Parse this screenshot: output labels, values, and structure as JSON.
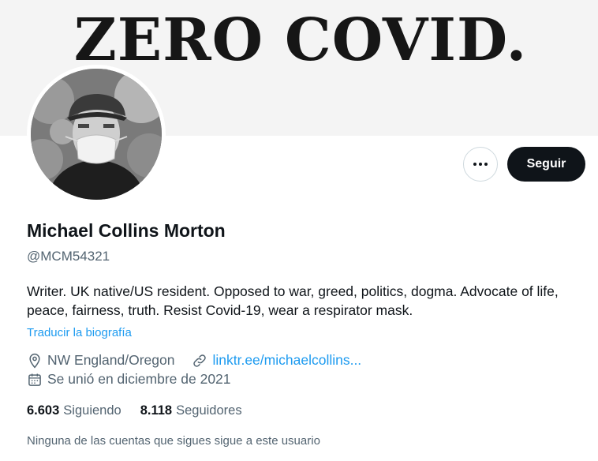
{
  "banner": {
    "text": "ZERO COVID."
  },
  "actions": {
    "follow_label": "Seguir"
  },
  "profile": {
    "name": "Michael Collins Morton",
    "handle": "@MCM54321",
    "bio": "Writer. UK native/US resident. Opposed to war, greed, politics, dogma. Advocate of life, peace, fairness, truth. Resist Covid-19, wear a respirator mask.",
    "translate_label": "Traducir la biografía",
    "location": "NW England/Oregon",
    "website": "linktr.ee/michaelcollins...",
    "joined": "Se unió en diciembre de 2021"
  },
  "stats": {
    "following_count": "6.603",
    "following_label": "Siguiendo",
    "followers_count": "8.118",
    "followers_label": "Seguidores"
  },
  "followers_note": "Ninguna de las cuentas que sigues sigue a este usuario",
  "colors": {
    "accent": "#1d9bf0",
    "text": "#0f1419",
    "muted": "#536471",
    "button": "#0f1419"
  }
}
